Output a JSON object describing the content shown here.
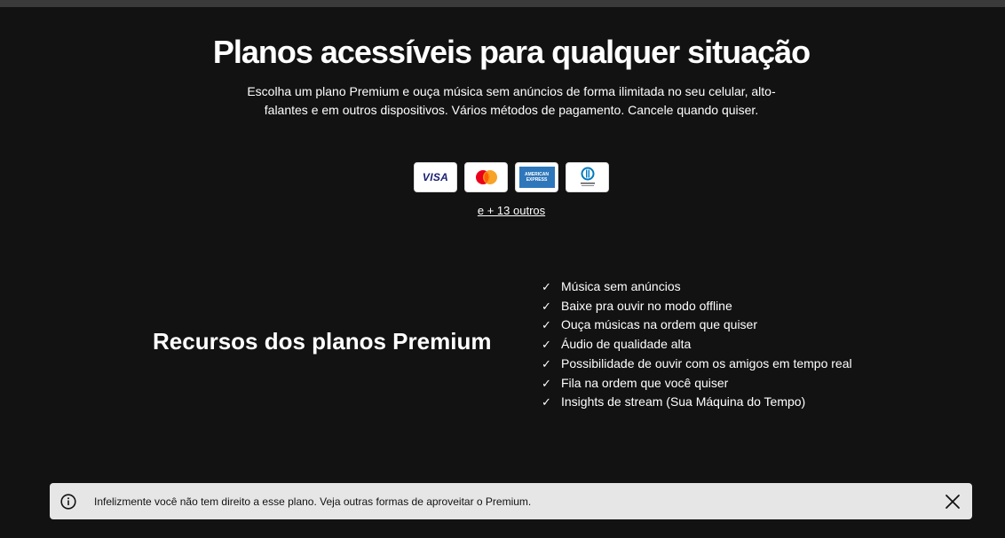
{
  "hero": {
    "title": "Planos acessíveis para qualquer situação",
    "subtitle": "Escolha um plano Premium e ouça música sem anúncios de forma ilimitada no seu celular, alto-falantes e em outros dispositivos. Vários métodos de pagamento. Cancele quando quiser."
  },
  "payments": {
    "cards": [
      {
        "name": "visa",
        "label": "VISA",
        "icon": "visa-icon"
      },
      {
        "name": "mastercard",
        "icon": "mastercard-icon"
      },
      {
        "name": "amex",
        "label_line1": "AMERICAN",
        "label_line2": "EXPRESS",
        "icon": "amex-icon"
      },
      {
        "name": "diners",
        "icon": "diners-club-icon"
      }
    ],
    "more_link": "e + 13 outros"
  },
  "features": {
    "title": "Recursos dos planos Premium",
    "check_glyph": "✓",
    "items": [
      "Música sem anúncios",
      "Baixe pra ouvir no modo offline",
      "Ouça músicas na ordem que quiser",
      "Áudio de qualidade alta",
      "Possibilidade de ouvir com os amigos em tempo real",
      "Fila na ordem que você quiser",
      "Insights de stream (Sua Máquina do Tempo)"
    ]
  },
  "toast": {
    "message": "Infelizmente você não tem direito a esse plano. Veja outras formas de aproveitar o Premium.",
    "info_icon": "info-icon",
    "close_icon": "close-icon"
  },
  "colors": {
    "background": "#121212",
    "toast_bg": "#e6e6e6",
    "amex_blue": "#2e77bb",
    "visa_blue": "#1a1f71",
    "mastercard_red": "#eb001b",
    "mastercard_orange": "#f79e1b",
    "diners_blue": "#0079be"
  }
}
